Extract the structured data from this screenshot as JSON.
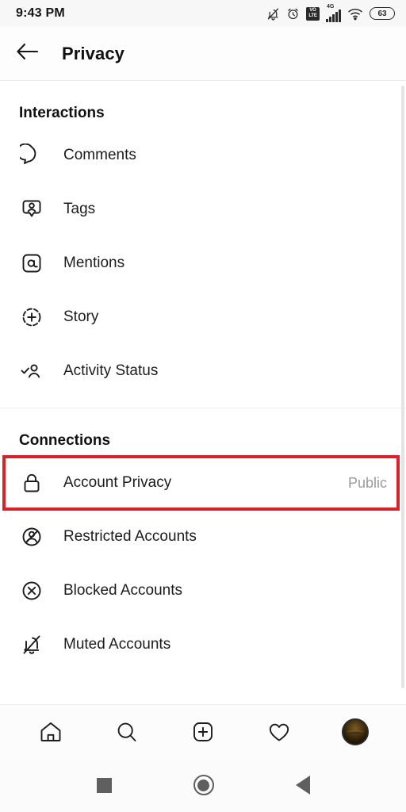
{
  "status_bar": {
    "time": "9:43 PM",
    "icons": [
      {
        "name": "silent-bell-icon"
      },
      {
        "name": "alarm-clock-icon"
      },
      {
        "name": "volte-icon",
        "line1": "VO",
        "line2": "LTE"
      },
      {
        "name": "signal-4g-icon",
        "network": "4G"
      },
      {
        "name": "wifi-icon"
      },
      {
        "name": "battery-icon",
        "level": "63"
      }
    ]
  },
  "header": {
    "back_label": "Back",
    "title": "Privacy"
  },
  "sections": [
    {
      "title": "Interactions",
      "items": [
        {
          "icon": "comment-bubble-icon",
          "label": "Comments",
          "value": ""
        },
        {
          "icon": "tag-person-icon",
          "label": "Tags",
          "value": ""
        },
        {
          "icon": "mention-at-icon",
          "label": "Mentions",
          "value": ""
        },
        {
          "icon": "story-plus-icon",
          "label": "Story",
          "value": ""
        },
        {
          "icon": "activity-status-icon",
          "label": "Activity Status",
          "value": ""
        }
      ]
    },
    {
      "title": "Connections",
      "items": [
        {
          "icon": "lock-icon",
          "label": "Account Privacy",
          "value": "Public",
          "highlighted": true
        },
        {
          "icon": "restricted-account-icon",
          "label": "Restricted Accounts",
          "value": ""
        },
        {
          "icon": "blocked-account-icon",
          "label": "Blocked Accounts",
          "value": ""
        },
        {
          "icon": "muted-account-icon",
          "label": "Muted Accounts",
          "value": ""
        }
      ]
    }
  ],
  "highlight": {
    "color": "#d8232a",
    "target": "Account Privacy"
  },
  "bottom_nav": [
    {
      "icon": "home-icon",
      "label": "Home"
    },
    {
      "icon": "search-icon",
      "label": "Search"
    },
    {
      "icon": "create-post-icon",
      "label": "Create"
    },
    {
      "icon": "heart-activity-icon",
      "label": "Activity"
    },
    {
      "icon": "profile-avatar-icon",
      "label": "Profile"
    }
  ],
  "system_nav": [
    {
      "icon": "recents-square-icon",
      "label": "Recents"
    },
    {
      "icon": "home-circle-icon",
      "label": "Home"
    },
    {
      "icon": "back-triangle-icon",
      "label": "Back"
    }
  ]
}
